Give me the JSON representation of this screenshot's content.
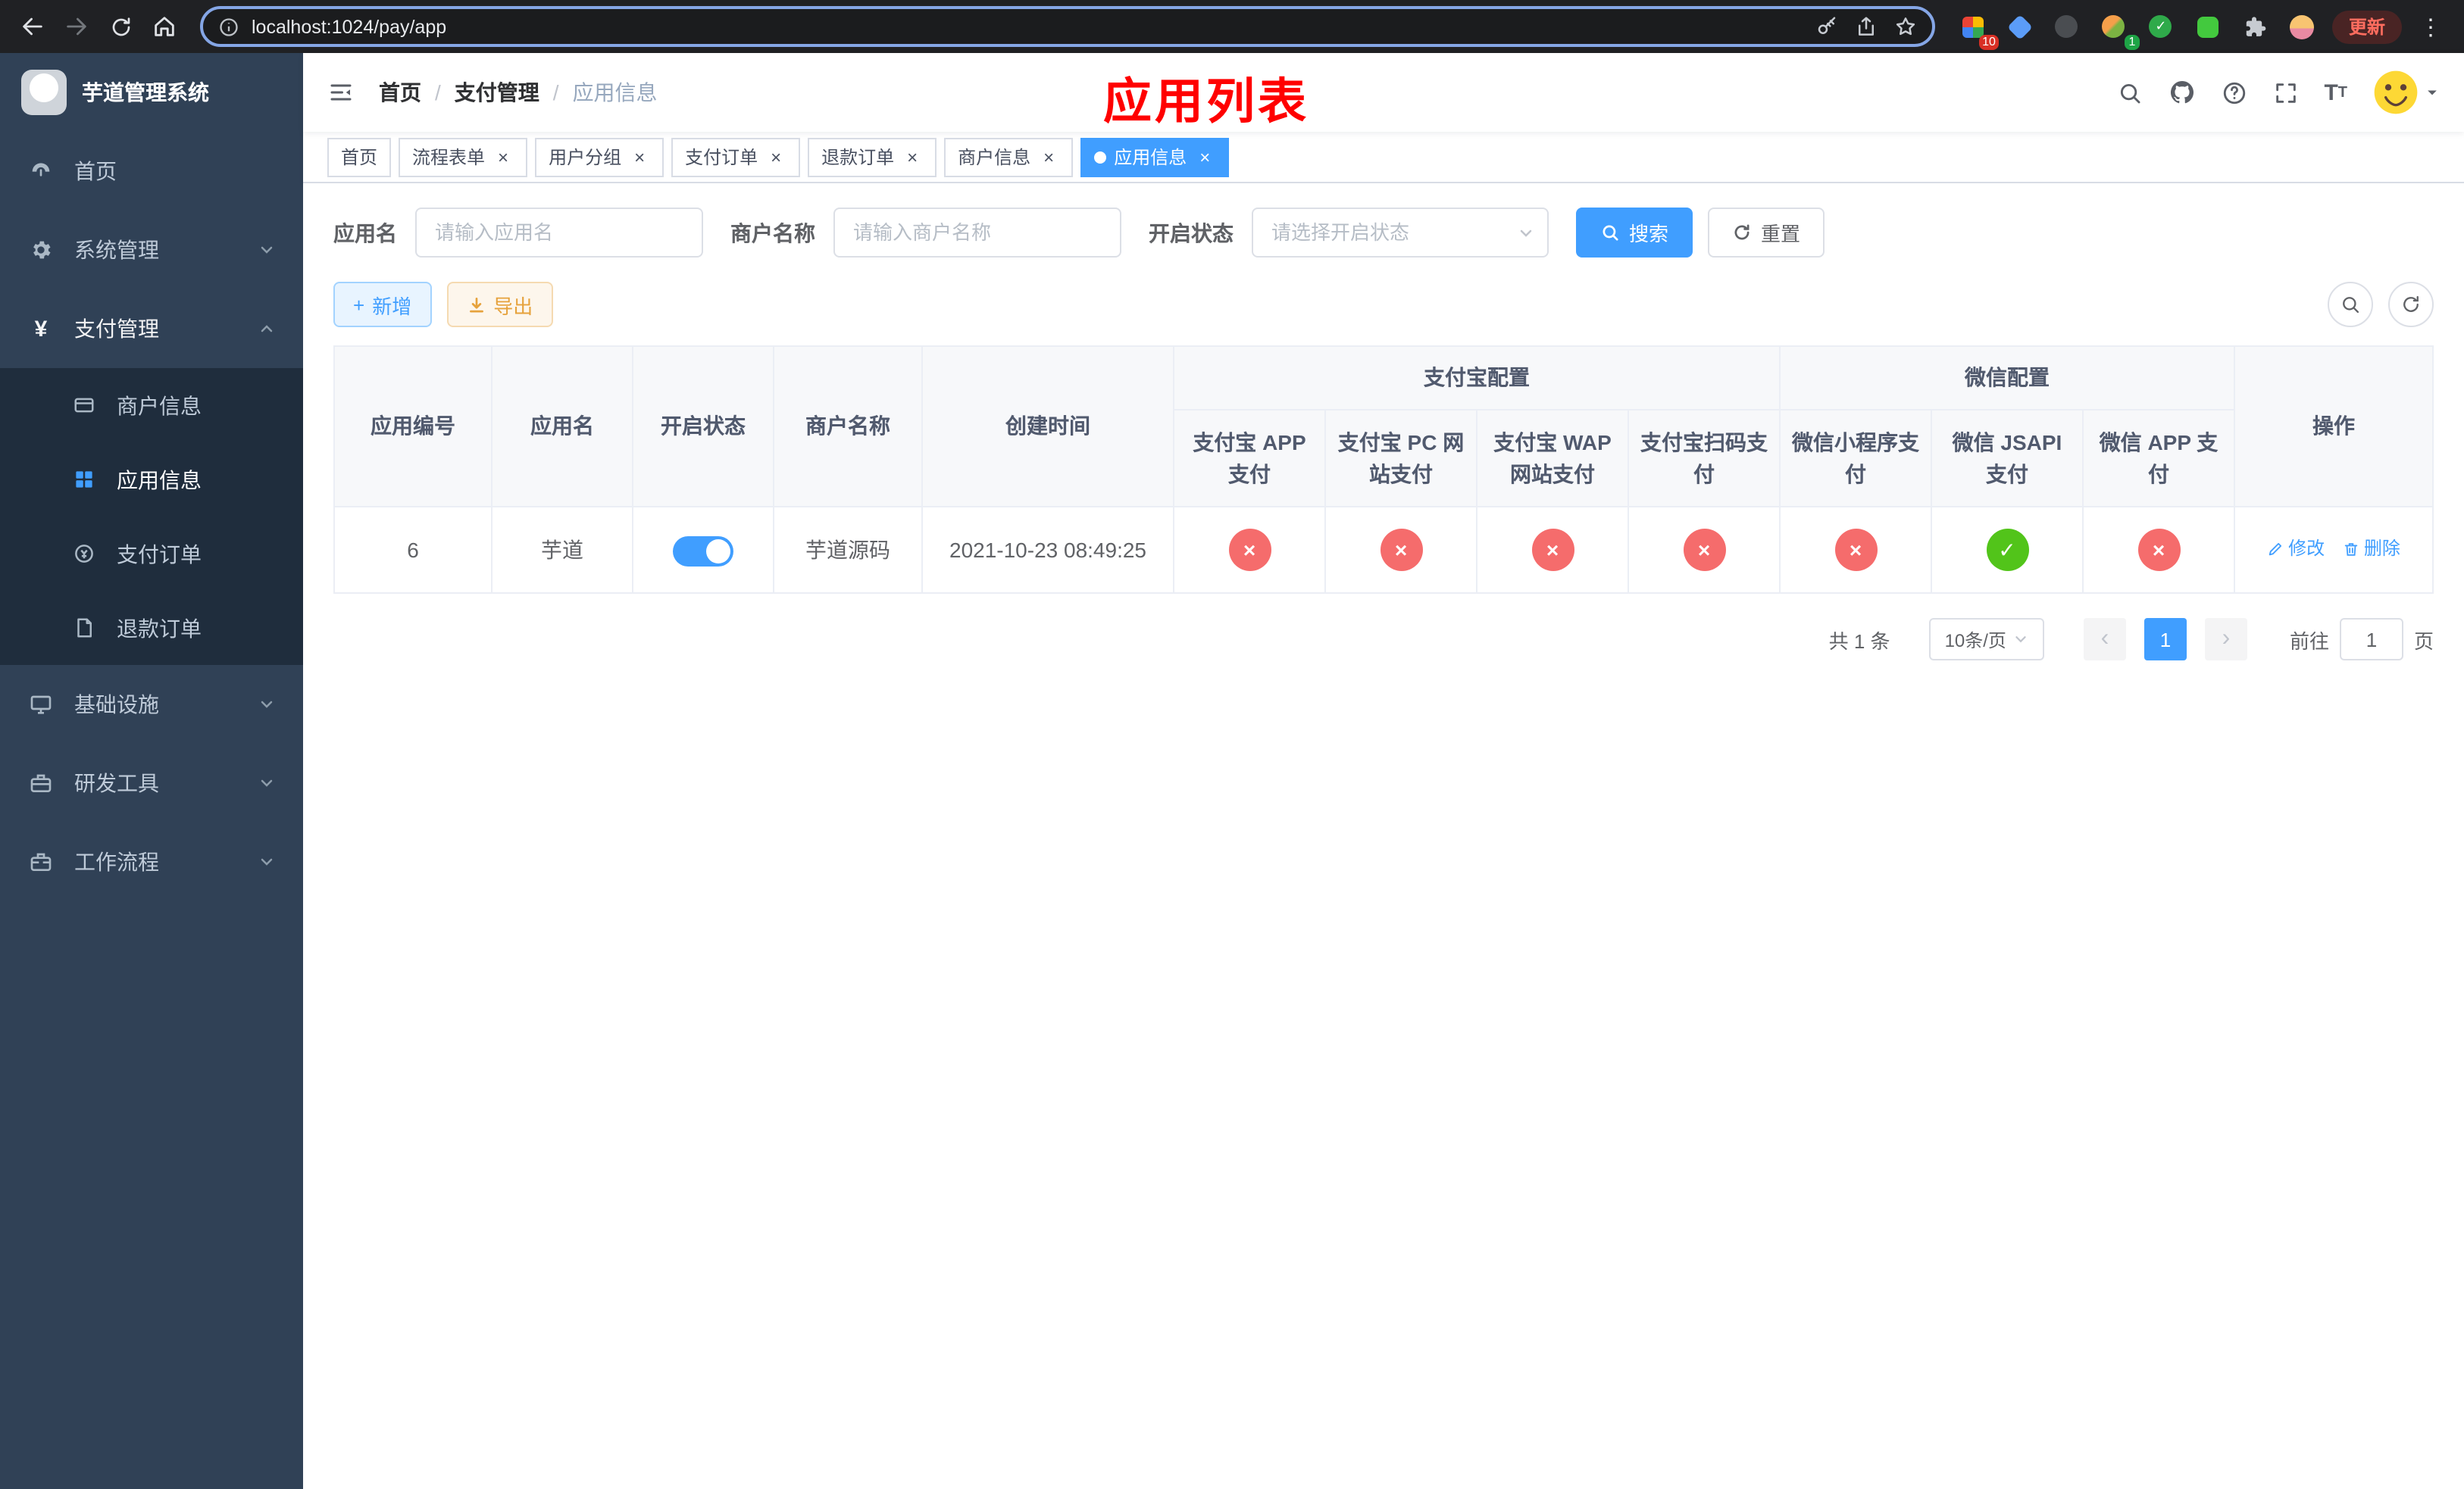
{
  "browser": {
    "url": "localhost:1024/pay/app",
    "update_label": "更新",
    "ext_badge_grid": "10",
    "ext_badge_avatar": "1"
  },
  "icons": {
    "close": "×",
    "check": "✓",
    "cross": "×",
    "plus": "+",
    "yen": "¥",
    "dots": "⋮",
    "prev": "‹",
    "next": "›",
    "font_large": "T",
    "font_small": "T"
  },
  "sidebar": {
    "app_title": "芋道管理系统",
    "items": [
      {
        "label": "首页"
      },
      {
        "label": "系统管理"
      },
      {
        "label": "支付管理"
      },
      {
        "label": "基础设施"
      },
      {
        "label": "研发工具"
      },
      {
        "label": "工作流程"
      }
    ],
    "pay_children": [
      {
        "label": "商户信息"
      },
      {
        "label": "应用信息"
      },
      {
        "label": "支付订单"
      },
      {
        "label": "退款订单"
      }
    ]
  },
  "header": {
    "breadcrumb": [
      {
        "label": "首页"
      },
      {
        "label": "支付管理"
      },
      {
        "label": "应用信息"
      }
    ],
    "separator": "/",
    "annotation": "应用列表"
  },
  "tabs": [
    {
      "label": "首页"
    },
    {
      "label": "流程表单"
    },
    {
      "label": "用户分组"
    },
    {
      "label": "支付订单"
    },
    {
      "label": "退款订单"
    },
    {
      "label": "商户信息"
    },
    {
      "label": "应用信息"
    }
  ],
  "filters": {
    "app_name_label": "应用名",
    "app_name_placeholder": "请输入应用名",
    "merchant_label": "商户名称",
    "merchant_placeholder": "请输入商户名称",
    "status_label": "开启状态",
    "status_placeholder": "请选择开启状态",
    "search_label": "搜索",
    "reset_label": "重置"
  },
  "toolbar": {
    "add_label": "新增",
    "export_label": "导出"
  },
  "table": {
    "group_alipay": "支付宝配置",
    "group_wechat": "微信配置",
    "col_app_id": "应用编号",
    "col_app_name": "应用名",
    "col_status": "开启状态",
    "col_merchant": "商户名称",
    "col_create_time": "创建时间",
    "col_alipay_app": "支付宝 APP 支付",
    "col_alipay_pc": "支付宝 PC 网站支付",
    "col_alipay_wap": "支付宝 WAP 网站支付",
    "col_alipay_qr": "支付宝扫码支付",
    "col_wx_mini": "微信小程序支付",
    "col_wx_jsapi": "微信 JSAPI 支付",
    "col_wx_app": "微信 APP 支付",
    "col_actions": "操作",
    "rows": [
      {
        "app_id": "6",
        "app_name": "芋道",
        "status_on": true,
        "merchant": "芋道源码",
        "create_time": "2021-10-23 08:49:25",
        "channels": [
          "no",
          "no",
          "no",
          "no",
          "no",
          "yes",
          "no"
        ],
        "edit_label": "修改",
        "delete_label": "删除"
      }
    ]
  },
  "pagination": {
    "total_text": "共 1 条",
    "page_size_text": "10条/页",
    "page": "1",
    "goto_label": "前往",
    "goto_value": "1",
    "page_unit": "页"
  },
  "colors": {
    "primary": "#409eff",
    "danger": "#f56c6c",
    "success": "#52c41a",
    "annotation_red": "#ff0000",
    "sidebar_bg": "#304156",
    "submenu_bg": "#1f2d3d"
  }
}
